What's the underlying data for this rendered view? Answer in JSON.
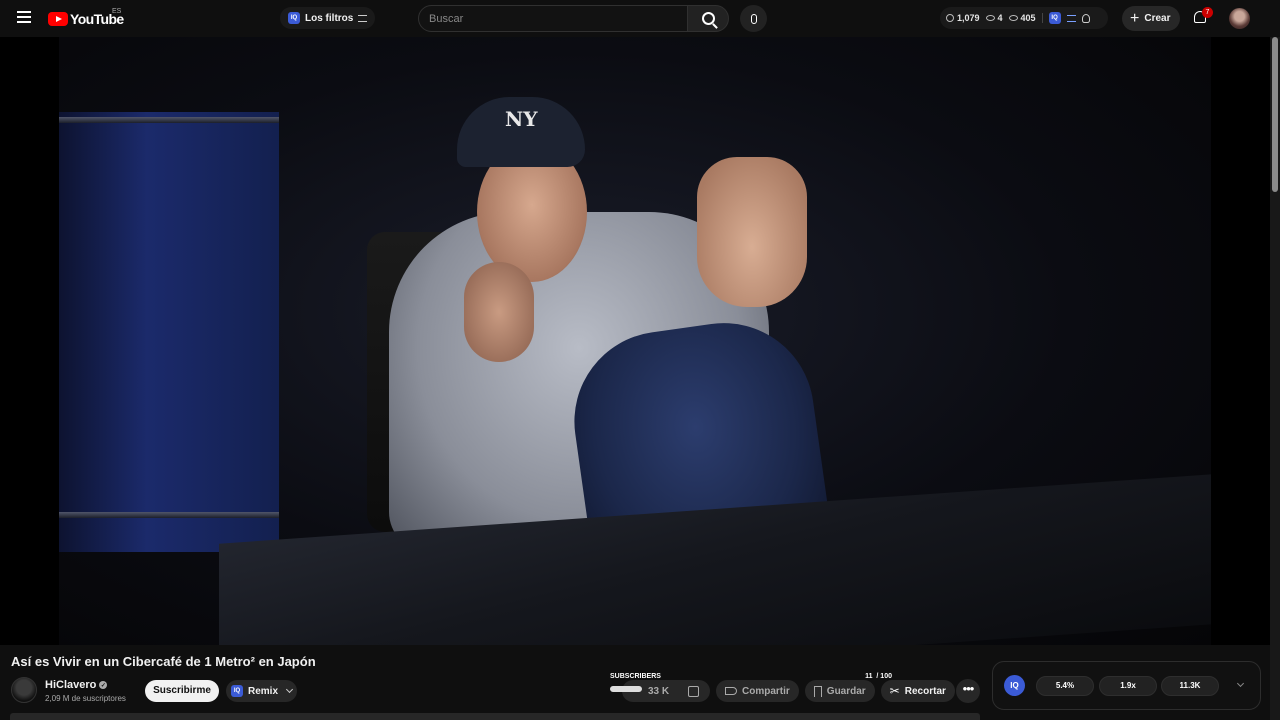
{
  "header": {
    "logo_text": "YouTube",
    "logo_country": "ES",
    "filters_label": "Los filtros",
    "iq_badge": "IQ",
    "search_placeholder": "Buscar",
    "stats": {
      "a": "1,079",
      "b": "4",
      "c": "405"
    },
    "create_label": "Crear",
    "notifications": "7"
  },
  "video": {
    "title": "Así es Vivir en un Cibercafé de 1 Metro² en Japón",
    "cap_logo": "NY"
  },
  "channel": {
    "name": "HiClavero",
    "verified": "✓",
    "subscribers": "2,09 M de suscriptores",
    "subscribe_label": "Suscribirme",
    "remix_label": "Remix"
  },
  "subs_strip": {
    "label": "SUBSCRIBERS",
    "progress_left": "11",
    "progress_right": "/ 100",
    "progress_fraction": 1.0
  },
  "actions": {
    "like_count": "33 K",
    "share_label": "Compartir",
    "save_label": "Guardar",
    "clip_label": "Recortar",
    "more_label": "•••"
  },
  "iq_panel": {
    "badge": "IQ",
    "metrics": [
      "5.4%",
      "1.9x",
      "11.3K"
    ]
  },
  "icons": {
    "menu": "menu-icon",
    "search": "search-icon",
    "mic": "mic-icon",
    "bell": "bell-icon",
    "plus": "plus-icon"
  },
  "colors": {
    "brand_red": "#ff0000",
    "iq_blue": "#3b5bd6",
    "background": "#0f0f0f"
  }
}
